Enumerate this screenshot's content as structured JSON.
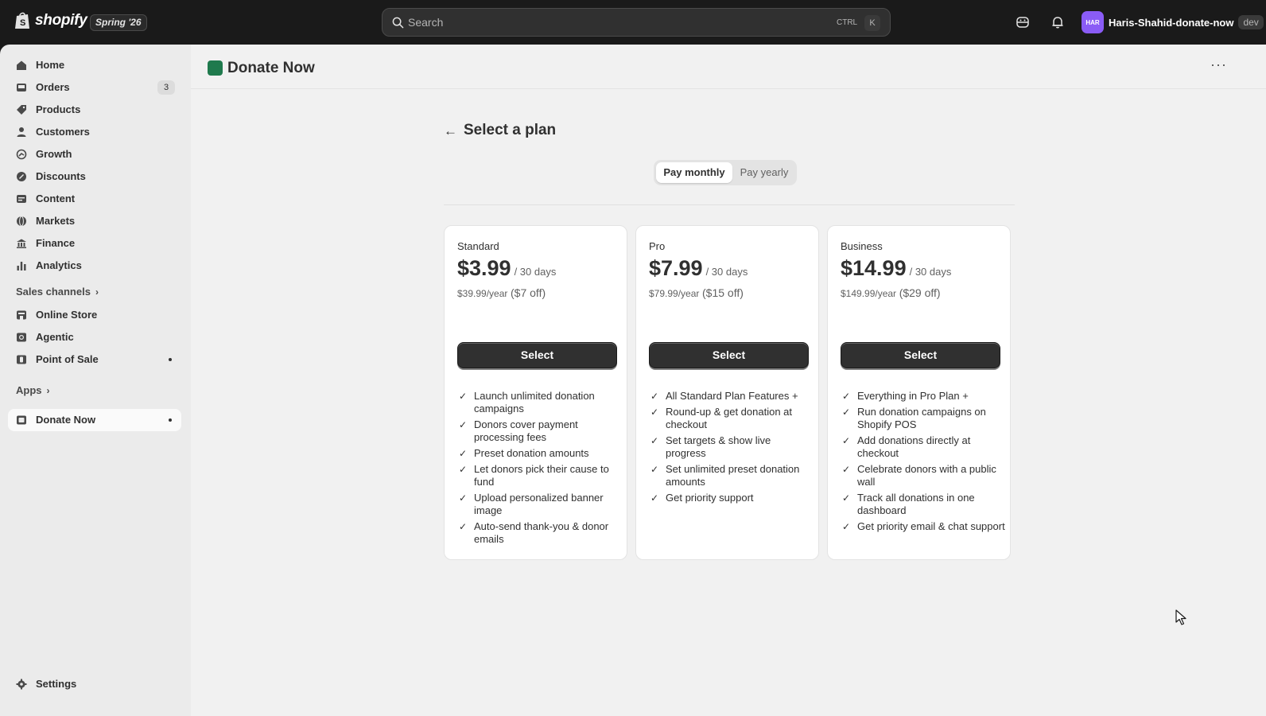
{
  "topbar": {
    "brand": "shopify",
    "edition_badge": "Spring '26",
    "search_label": "Search",
    "search_shortcut_ctrl": "CTRL",
    "search_shortcut_key": "K",
    "avatar_initials": "HAR",
    "store_name": "Haris-Shahid-donate-now",
    "env_badge": "dev",
    "icons": [
      "sidekick-icon",
      "bell-icon"
    ]
  },
  "sidebar": {
    "items": [
      {
        "label": "Home",
        "icon": "home-icon"
      },
      {
        "label": "Orders",
        "icon": "inbox-icon",
        "count": "3"
      },
      {
        "label": "Products",
        "icon": "tag-icon"
      },
      {
        "label": "Customers",
        "icon": "person-icon"
      },
      {
        "label": "Growth",
        "icon": "growth-icon"
      },
      {
        "label": "Discounts",
        "icon": "discount-icon"
      },
      {
        "label": "Content",
        "icon": "content-icon"
      },
      {
        "label": "Markets",
        "icon": "globe-icon"
      },
      {
        "label": "Finance",
        "icon": "bank-icon"
      },
      {
        "label": "Analytics",
        "icon": "bar-chart-icon"
      }
    ],
    "sales_channels_label": "Sales channels",
    "channels": [
      {
        "label": "Online Store",
        "icon": "store-icon"
      },
      {
        "label": "Agentic",
        "icon": "agentic-icon"
      },
      {
        "label": "Point of Sale",
        "icon": "pos-icon"
      }
    ],
    "apps_label": "Apps",
    "apps": [
      {
        "label": "Donate Now",
        "icon": "donate-now-app-icon"
      }
    ],
    "settings_label": "Settings"
  },
  "app": {
    "title": "Donate Now",
    "more_label": "···"
  },
  "plans_page": {
    "back_label": "←",
    "title": "Select a plan",
    "billing_toggle": {
      "monthly": "Pay monthly",
      "yearly": "Pay yearly",
      "selected": "monthly"
    },
    "plans": [
      {
        "name": "Standard",
        "price": "$3.99",
        "period": "/ 30 days",
        "yearly_price": "$39.99/year",
        "yearly_savings": "($7 off)",
        "button": "Select",
        "features": [
          "Launch unlimited donation campaigns",
          "Donors cover payment processing fees",
          "Preset donation amounts",
          "Let donors pick their cause to fund",
          "Upload personalized banner image",
          "Auto-send thank-you & donor emails"
        ]
      },
      {
        "name": "Pro",
        "price": "$7.99",
        "period": "/ 30 days",
        "yearly_price": "$79.99/year",
        "yearly_savings": "($15 off)",
        "button": "Select",
        "features": [
          "All Standard Plan Features +",
          "Round-up & get donation at checkout",
          "Set targets & show live progress",
          "Set unlimited preset donation amounts",
          "Get priority support"
        ]
      },
      {
        "name": "Business",
        "price": "$14.99",
        "period": "/ 30 days",
        "yearly_price": "$149.99/year",
        "yearly_savings": "($29 off)",
        "button": "Select",
        "features": [
          "Everything in Pro Plan +",
          "Run donation campaigns on Shopify POS",
          "Add donations directly at checkout",
          "Celebrate donors with a public wall",
          "Track all donations in one dashboard",
          "Get priority email & chat support"
        ]
      }
    ]
  },
  "colors": {
    "topbar_bg": "#1a1a1a",
    "sidebar_bg": "#ebebeb",
    "main_bg": "#f1f1f1",
    "primary_button": "#303030",
    "avatar": "#8a5cf6",
    "app_logo": "#1f7a4d"
  }
}
